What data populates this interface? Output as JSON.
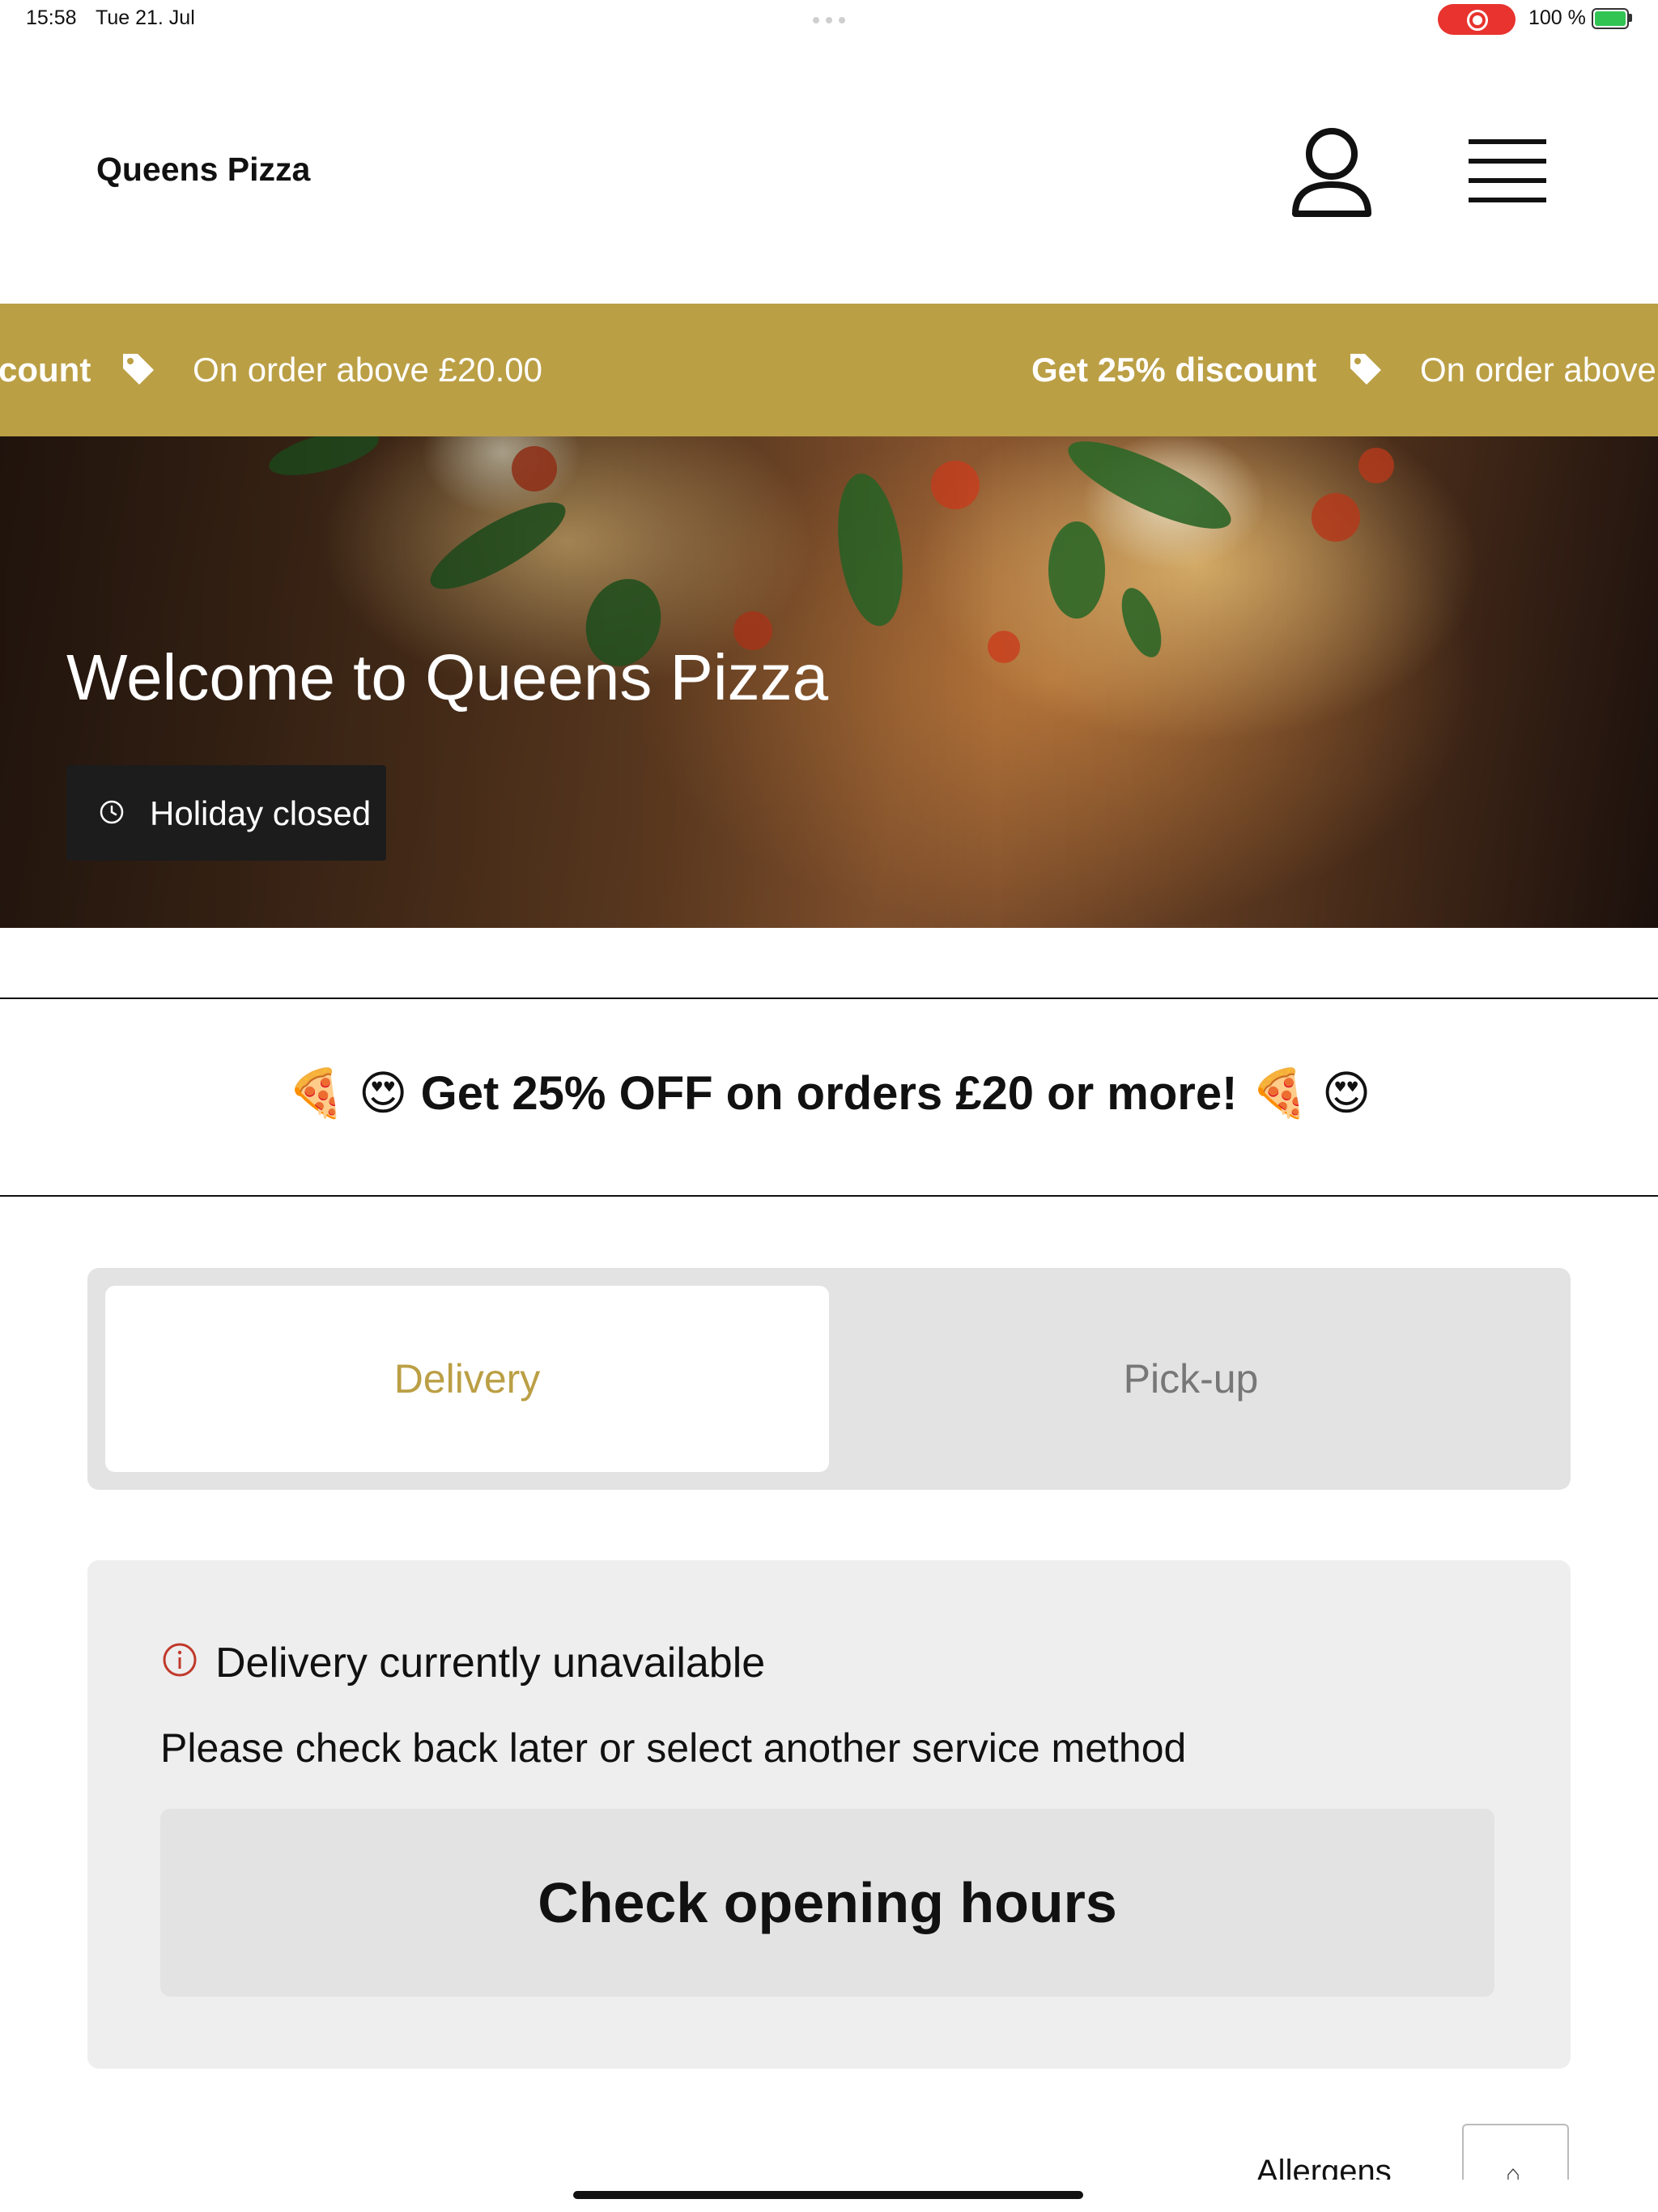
{
  "status_bar": {
    "time": "15:58",
    "date": "Tue 21. Jul",
    "battery": "100 %"
  },
  "header": {
    "brand": "Queens Pizza",
    "icons": [
      "user-icon",
      "menu-icon"
    ]
  },
  "promo_ticker": {
    "items": [
      {
        "text": "count",
        "bold": true
      },
      {
        "text": "On order above £20.00",
        "bold": false
      },
      {
        "text": "Get 25% discount",
        "bold": true
      },
      {
        "text": "On order above £",
        "bold": false
      }
    ],
    "color": "#bb9f45"
  },
  "hero": {
    "title": "Welcome to Queens Pizza",
    "status": "Holiday closed"
  },
  "offer_banner": {
    "text": "🍕 😍 Get 25% OFF on orders £20 or more! 🍕 😍"
  },
  "service_toggle": {
    "tabs": [
      {
        "label": "Delivery",
        "selected": true
      },
      {
        "label": "Pick-up",
        "selected": false
      }
    ],
    "accent": "#bb9f45"
  },
  "notice": {
    "title": "Delivery currently unavailable",
    "message": "Please check back later or select another service method",
    "button": "Check opening hours",
    "icon_color": "#c0392b"
  },
  "footer": {
    "allergens": "Allergens"
  }
}
